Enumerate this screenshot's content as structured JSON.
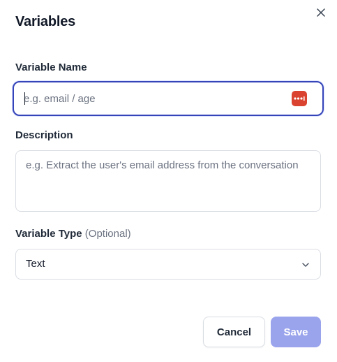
{
  "dialog": {
    "title": "Variables"
  },
  "fields": {
    "name": {
      "label": "Variable Name",
      "placeholder": "e.g. email / age",
      "value": ""
    },
    "description": {
      "label": "Description",
      "placeholder": "e.g. Extract the user's email address from the conversation",
      "value": ""
    },
    "type": {
      "label": "Variable Type",
      "optional_label": "(Optional)",
      "selected": "Text"
    }
  },
  "actions": {
    "cancel_label": "Cancel",
    "save_label": "Save"
  },
  "icons": {
    "close": "close-icon",
    "password_manager": "password-manager-icon",
    "chevron": "chevron-down-icon"
  },
  "colors": {
    "focus_border": "#3544b8",
    "save_button": "#9aa4ec",
    "password_icon_bg": "#d9432f"
  }
}
